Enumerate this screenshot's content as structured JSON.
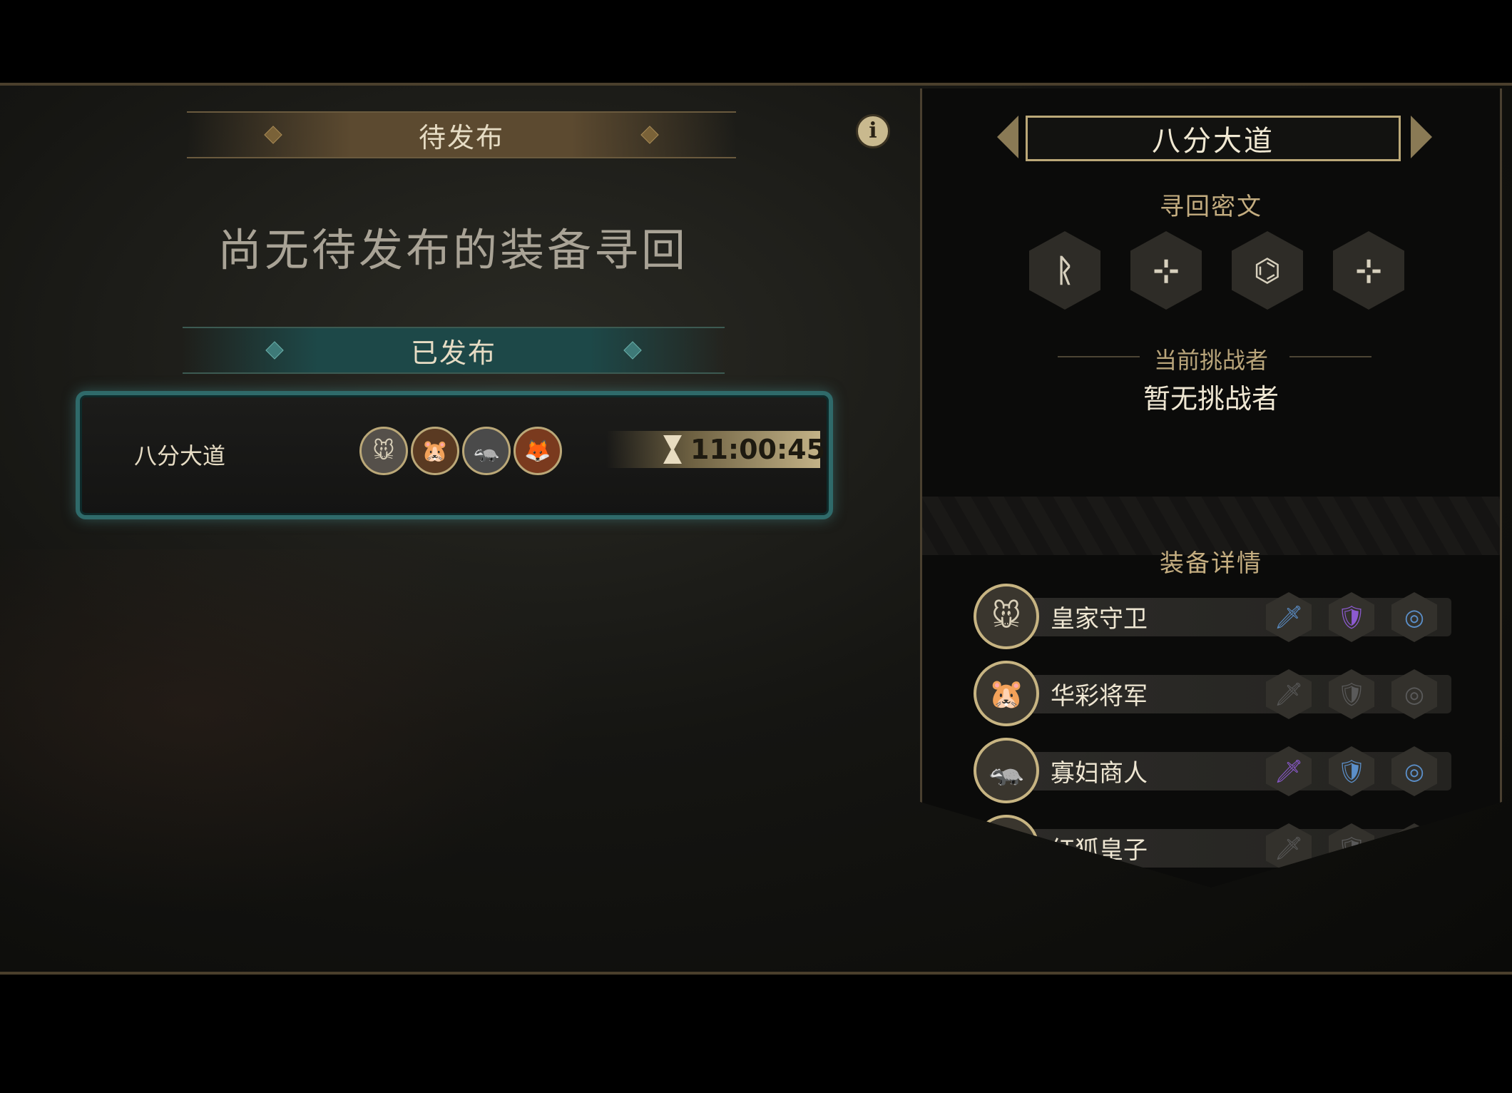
{
  "left": {
    "pending_banner": "待发布",
    "empty_message": "尚无待发布的装备寻回",
    "published_banner": "已发布",
    "info_icon": "i",
    "quest": {
      "name": "八分大道",
      "portraits": [
        {
          "icon": "🐭"
        },
        {
          "icon": "🐹"
        },
        {
          "icon": "🦡"
        },
        {
          "icon": "🦊"
        }
      ],
      "timer": "11:00:45"
    }
  },
  "right": {
    "map_title": "八分大道",
    "runes_title": "寻回密文",
    "runes": [
      "ᚱ",
      "⊹",
      "⌬",
      "⊹"
    ],
    "challenger_label": "当前挑战者",
    "challenger_value": "暂无挑战者",
    "equip_title": "装备详情",
    "heroes": [
      {
        "name": "皇家守卫",
        "avatar": "🐭",
        "slots": [
          {
            "icon": "🗡",
            "color": "#5b8fc9"
          },
          {
            "icon": "🛡",
            "color": "#8c5ad0"
          },
          {
            "icon": "◎",
            "color": "#5b8fc9"
          }
        ]
      },
      {
        "name": "华彩将军",
        "avatar": "🐹",
        "slots": [
          {
            "icon": "🗡",
            "color": "#5a5a5a"
          },
          {
            "icon": "🛡",
            "color": "#5a5a5a"
          },
          {
            "icon": "◎",
            "color": "#5a5a5a"
          }
        ]
      },
      {
        "name": "寡妇商人",
        "avatar": "🦡",
        "slots": [
          {
            "icon": "🗡",
            "color": "#8c5ad0"
          },
          {
            "icon": "🛡",
            "color": "#5b8fc9"
          },
          {
            "icon": "◎",
            "color": "#5b8fc9"
          }
        ]
      },
      {
        "name": "红狐皇子",
        "avatar": "🦊",
        "slots": [
          {
            "icon": "🗡",
            "color": "#5a5a5a"
          },
          {
            "icon": "🛡",
            "color": "#5a5a5a"
          },
          {
            "icon": "◎",
            "color": "#5a5a5a"
          }
        ]
      }
    ]
  },
  "colors": {
    "gold_border": "#bba878",
    "teal_glow": "#2f6a6a",
    "rare_blue": "#5b8fc9",
    "epic_purple": "#8c5ad0"
  }
}
